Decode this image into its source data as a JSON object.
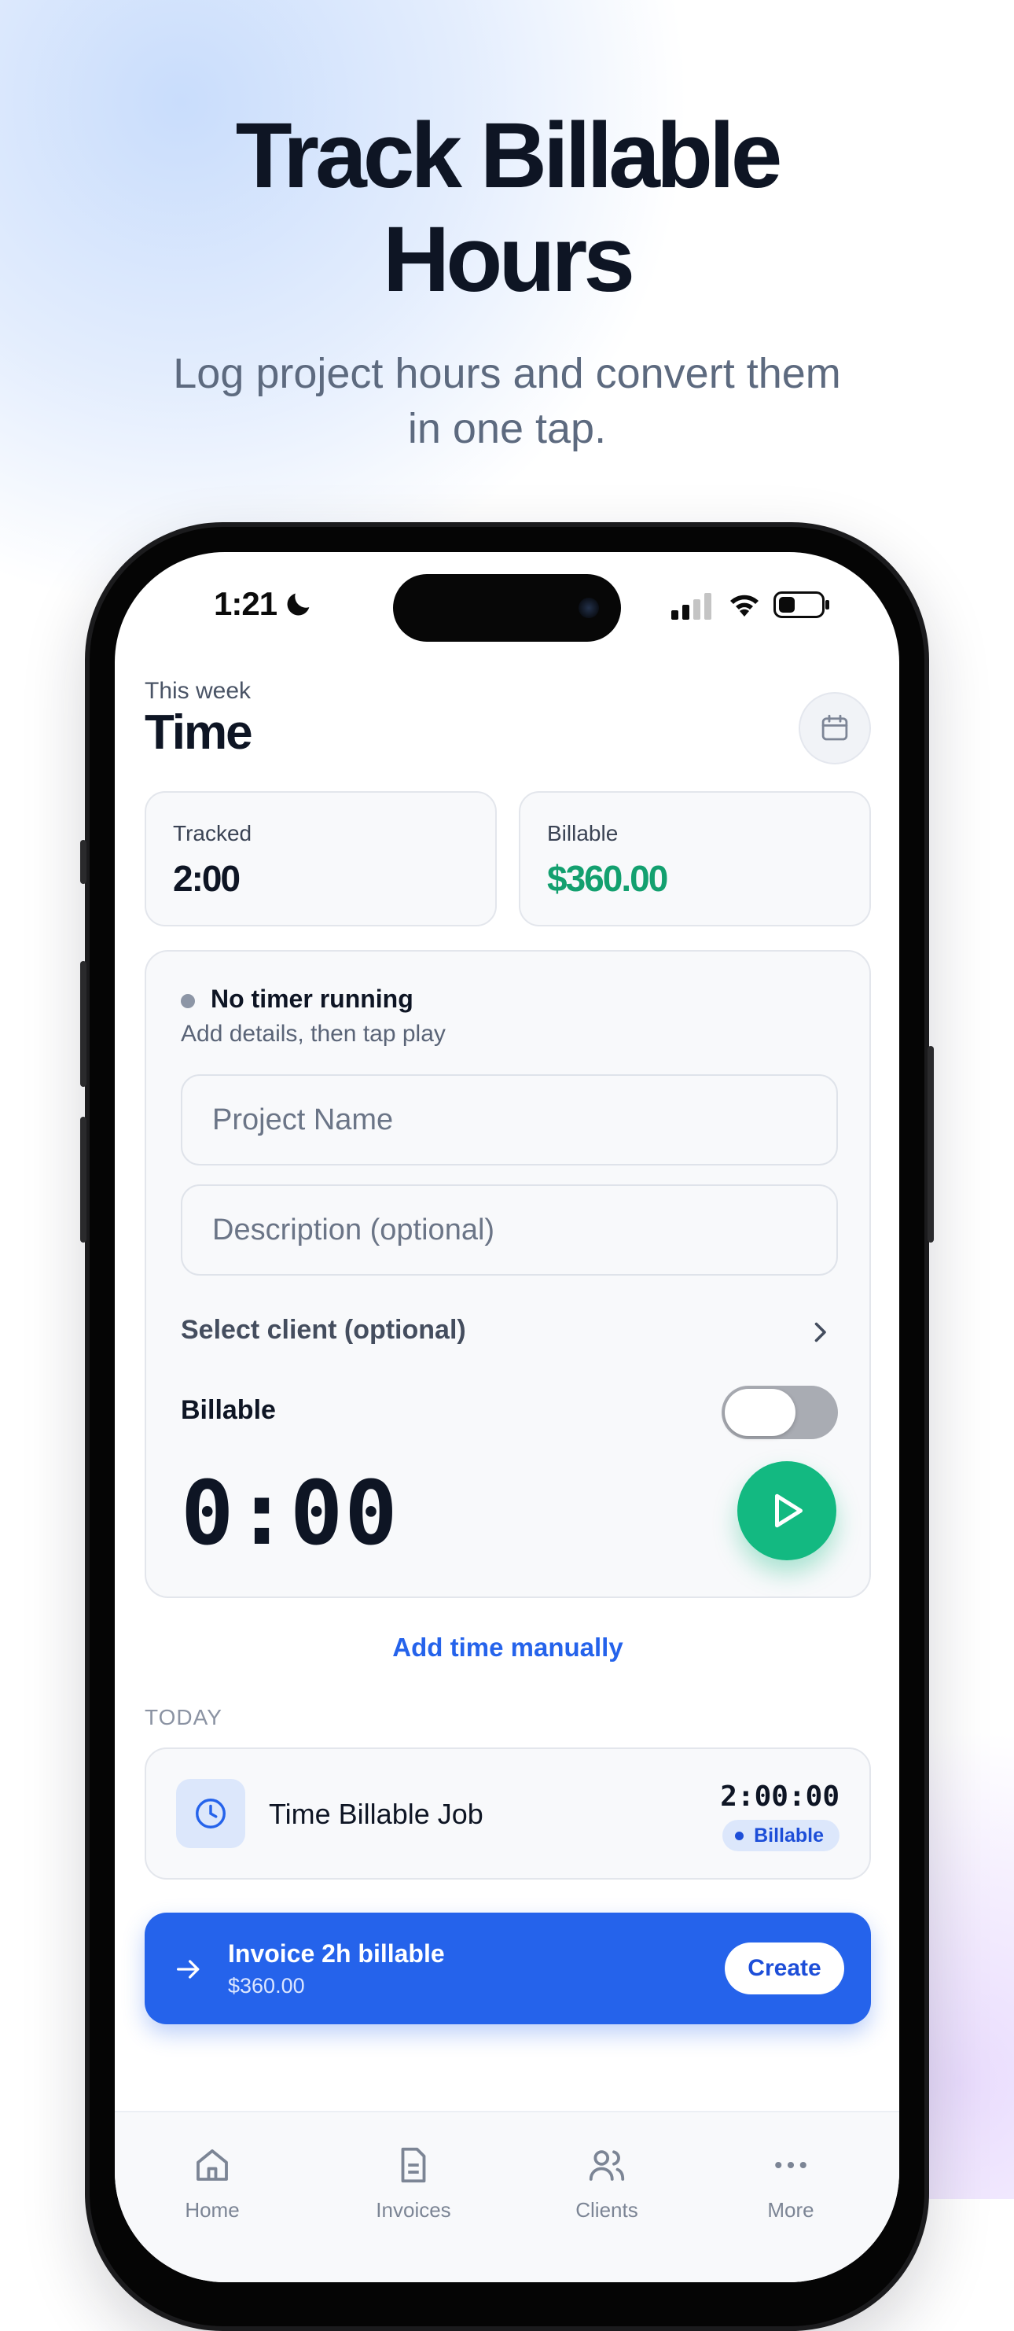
{
  "hero": {
    "title_line1": "Track Billable",
    "title_line2": "Hours",
    "subtitle": "Log project hours and convert them in one tap."
  },
  "status_bar": {
    "time": "1:21"
  },
  "header": {
    "week_label": "This week",
    "title": "Time"
  },
  "stats": {
    "tracked_label": "Tracked",
    "tracked_value": "2:00",
    "billable_label": "Billable",
    "billable_value": "$360.00",
    "billable_color": "#13a06f"
  },
  "timer": {
    "status": "No timer running",
    "hint": "Add details, then tap play",
    "project_placeholder": "Project Name",
    "description_placeholder": "Description (optional)",
    "client_select": "Select client (optional)",
    "billable_label": "Billable",
    "billable_on": false,
    "display": "0:00"
  },
  "add_manual": "Add time manually",
  "today": {
    "section_label": "TODAY",
    "entries": [
      {
        "name": "Time Billable Job",
        "duration": "2:00:00",
        "badge": "Billable"
      }
    ]
  },
  "invoice": {
    "title": "Invoice 2h billable",
    "amount": "$360.00",
    "button": "Create"
  },
  "tabs": [
    {
      "icon": "home-icon",
      "label": "Home"
    },
    {
      "icon": "document-icon",
      "label": "Invoices"
    },
    {
      "icon": "users-icon",
      "label": "Clients"
    },
    {
      "icon": "more-icon",
      "label": "More"
    }
  ],
  "colors": {
    "accent_blue": "#2563eb",
    "play_green": "#13b981"
  }
}
